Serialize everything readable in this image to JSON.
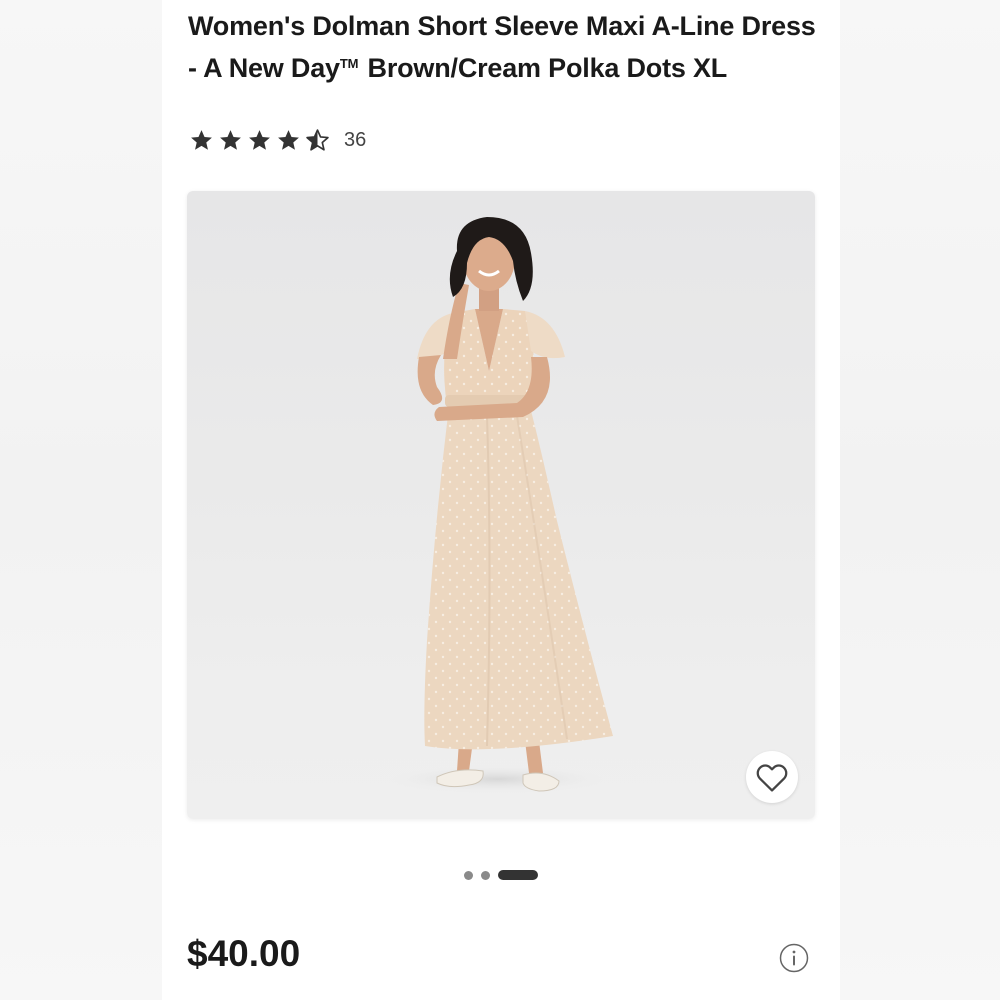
{
  "product": {
    "title_part1": "Women's Dolman Short Sleeve Maxi A-Line Dress - A New Day",
    "trademark": "TM",
    "title_part2": " Brown/Cream Polka Dots XL",
    "rating": 4.5,
    "rating_max": 5,
    "review_count": "36",
    "price": "$40.00"
  },
  "gallery": {
    "image_count": 3,
    "active_index": 2
  },
  "icons": {
    "star": "star-icon",
    "favorite": "heart-outline-icon",
    "info": "info-circle-icon"
  },
  "colors": {
    "star_fill": "#333333",
    "active_dot": "#333333",
    "inactive_dot": "#8a8a8a"
  }
}
